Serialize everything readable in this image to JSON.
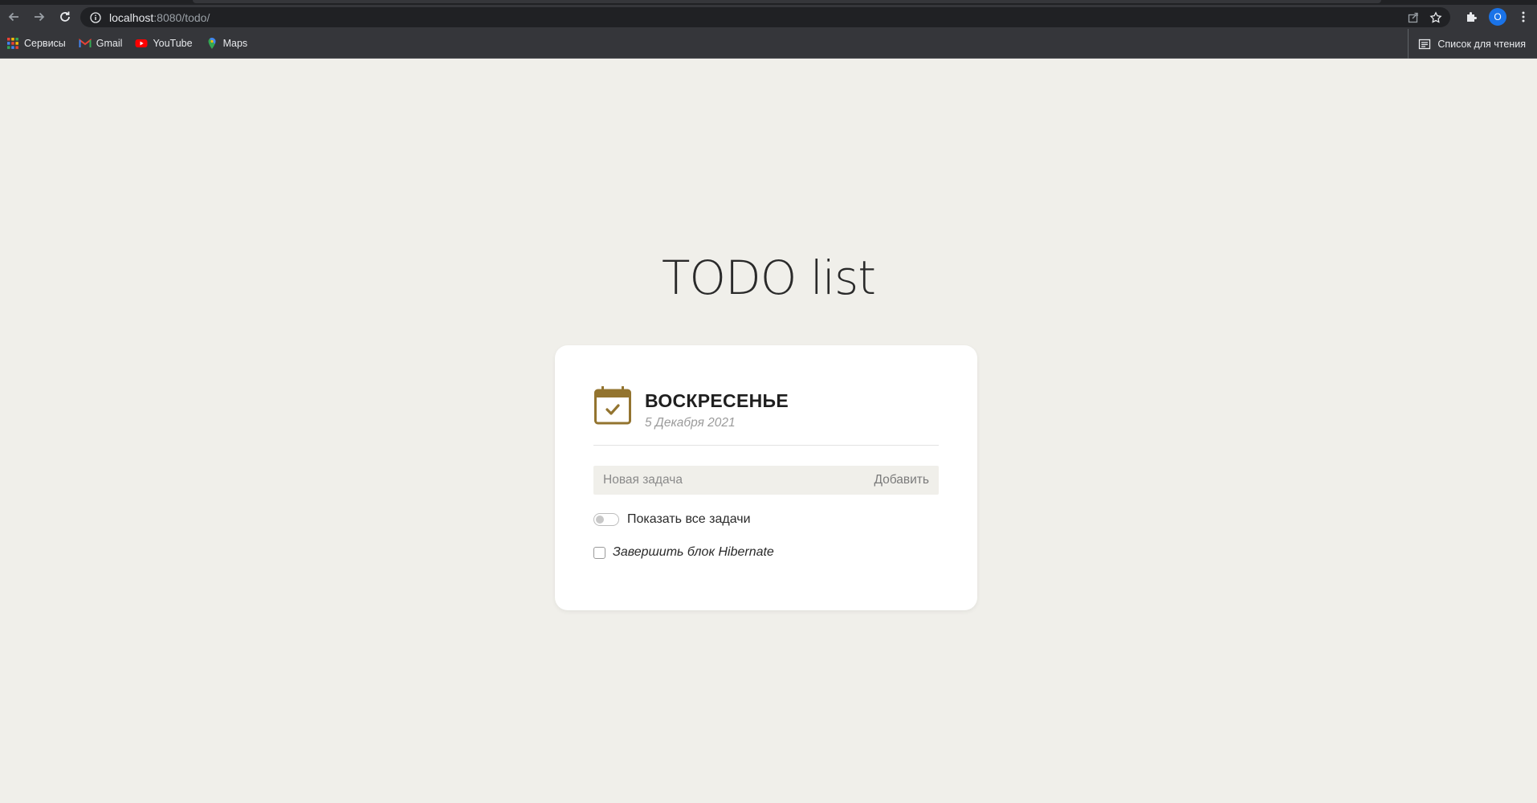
{
  "browser": {
    "url_host": "localhost",
    "url_rest": ":8080/todo/",
    "avatar_letter": "O",
    "bookmarks": [
      {
        "label": "Сервисы",
        "icon": "apps-grid-icon"
      },
      {
        "label": "Gmail",
        "icon": "gmail-icon"
      },
      {
        "label": "YouTube",
        "icon": "youtube-icon"
      },
      {
        "label": "Maps",
        "icon": "maps-icon"
      }
    ],
    "reading_list": "Список для чтения"
  },
  "page": {
    "title": "TODO list"
  },
  "card": {
    "day": "ВОСКРЕСЕНЬЕ",
    "date": "5 Декабря 2021",
    "new_task_placeholder": "Новая задача",
    "add_label": "Добавить",
    "show_all_label": "Показать все задачи",
    "show_all_enabled": false,
    "tasks": [
      {
        "text": "Завершить блок Hibernate",
        "done": false
      }
    ]
  },
  "colors": {
    "page_bg": "#f0efea",
    "accent_calendar": "#93742f",
    "chrome_bg": "#35363a"
  }
}
